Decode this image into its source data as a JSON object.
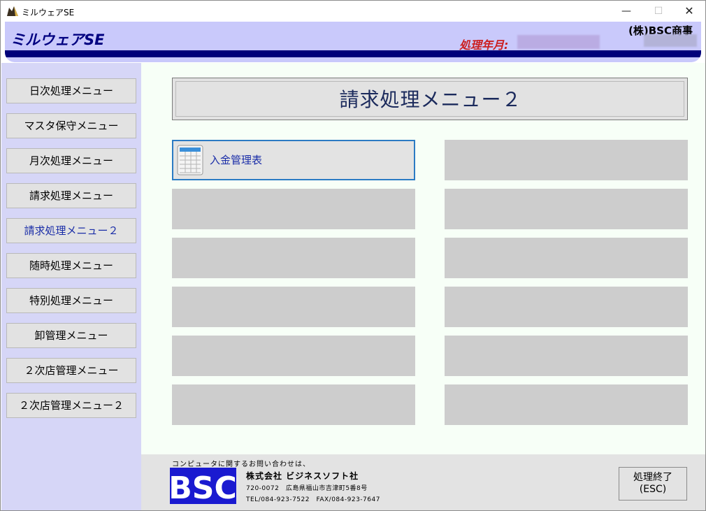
{
  "window": {
    "title": "ミルウェアSE",
    "minimize": "—",
    "maximize": "☐",
    "close": "✕"
  },
  "header": {
    "app_name": "ミルウェアSE",
    "processing_label": "処理年月:",
    "company": "(株)BSC商事"
  },
  "sidebar": {
    "items": [
      {
        "label": "日次処理メニュー"
      },
      {
        "label": "マスタ保守メニュー"
      },
      {
        "label": "月次処理メニュー"
      },
      {
        "label": "請求処理メニュー"
      },
      {
        "label": "請求処理メニュー２",
        "active": true
      },
      {
        "label": "随時処理メニュー"
      },
      {
        "label": "特別処理メニュー"
      },
      {
        "label": "卸管理メニュー"
      },
      {
        "label": "２次店管理メニュー"
      },
      {
        "label": "２次店管理メニュー２"
      }
    ]
  },
  "main": {
    "title": "請求処理メニュー２",
    "tiles": [
      {
        "label": "入金管理表",
        "icon": "spreadsheet-icon"
      }
    ]
  },
  "footer": {
    "inquiry": "コンピュータに関するお問い合わせは、",
    "logo_text": "BSC",
    "company": "株式会社 ビジネスソフト社",
    "address": "720-0072　広島県福山市吉津町5番8号",
    "contact": "TEL/084-923-7522　FAX/084-923-7647",
    "exit_label": "処理終了",
    "exit_key": "(ESC)"
  },
  "colors": {
    "accent_navy": "#00007a",
    "header_bg": "#c9c9fb",
    "sidebar_bg": "#d6d6f7",
    "active_text": "#1a2da8",
    "alert_red": "#cc1f1f",
    "logo_blue": "#1a1ad0"
  }
}
